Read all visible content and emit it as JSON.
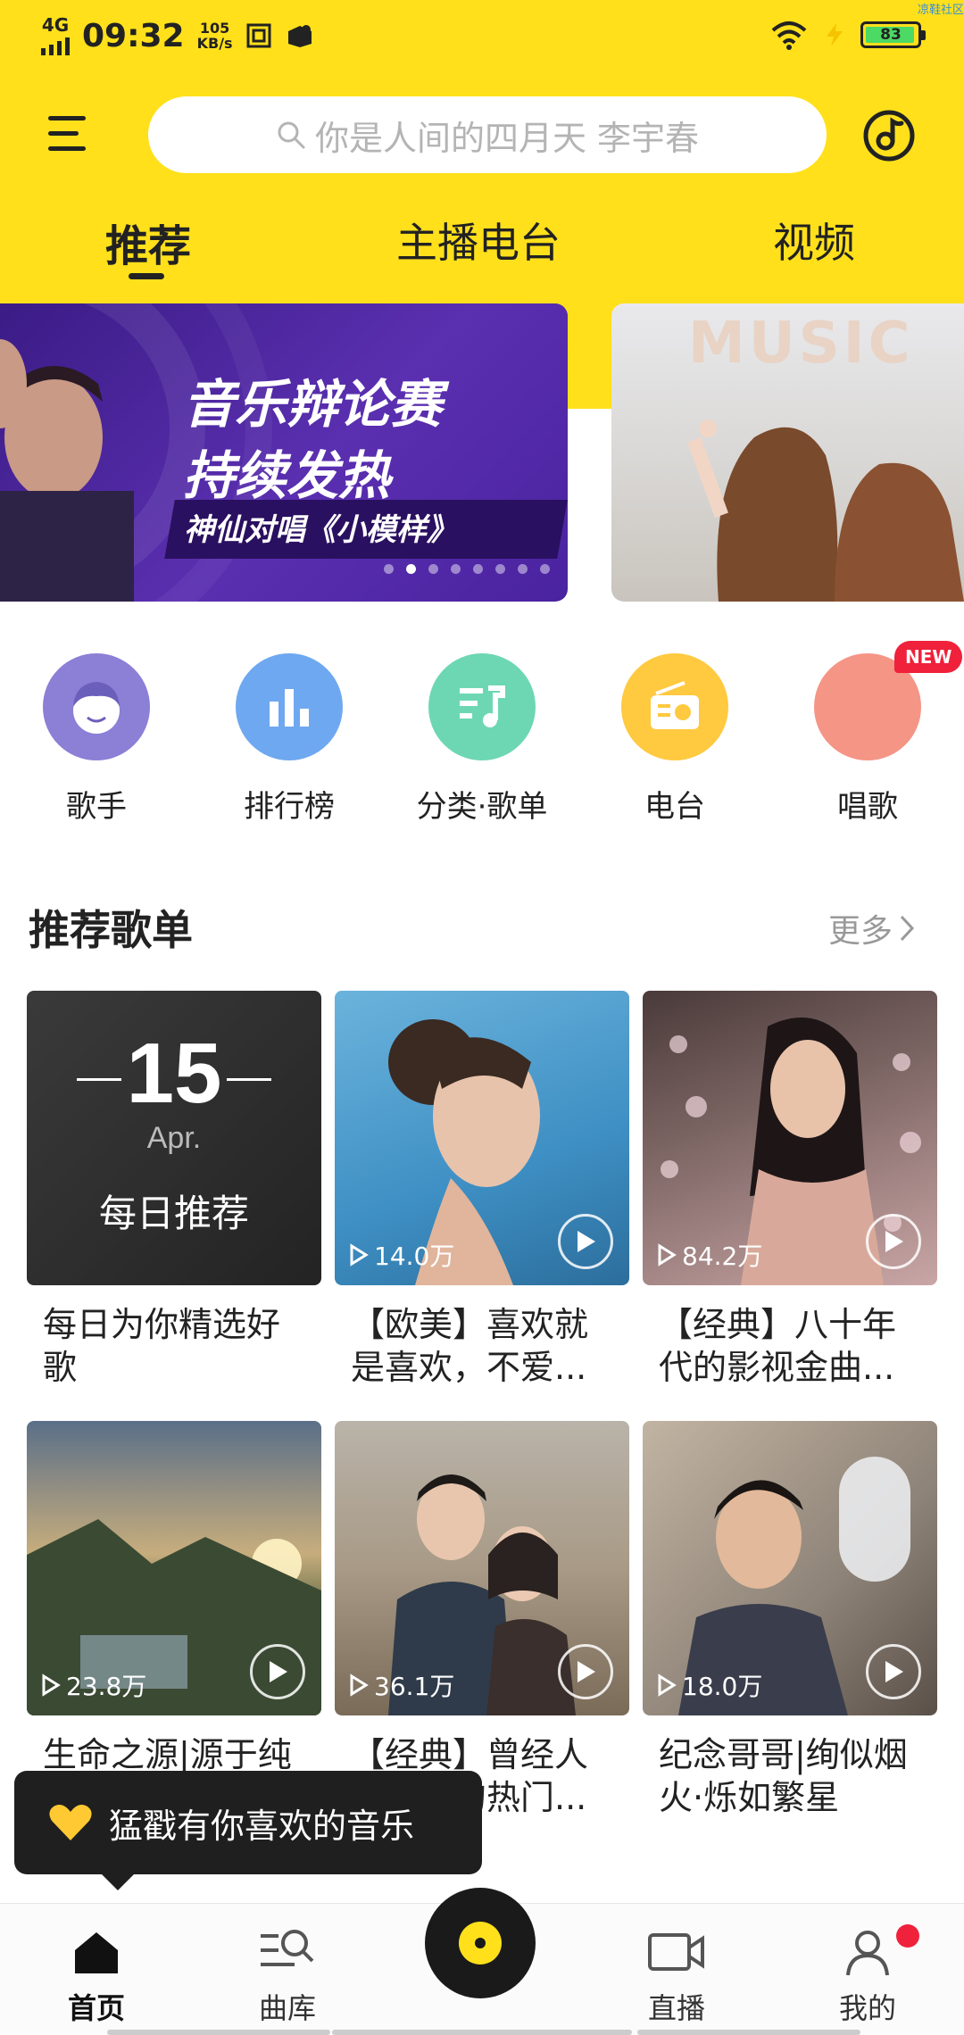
{
  "status_bar": {
    "network": "4G",
    "time": "09:32",
    "speed_value": "105",
    "speed_unit": "KB/s",
    "battery": "83",
    "corner_tag": "凉鞋社区"
  },
  "header": {
    "search_placeholder": "你是人间的四月天 李宇春",
    "tabs": [
      "推荐",
      "主播电台",
      "视频"
    ],
    "active_tab": 0
  },
  "banner": {
    "title_line1": "音乐辩论赛",
    "title_line2": "持续发热",
    "subtitle": "神仙对唱《小模样》",
    "side_text": "MUSIC",
    "dots_count": 8,
    "active_dot": 1
  },
  "categories": [
    {
      "label": "歌手",
      "icon": "singer-icon",
      "color": "#8b7fd6"
    },
    {
      "label": "排行榜",
      "icon": "chart-icon",
      "color": "#6ea8f0"
    },
    {
      "label": "分类·歌单",
      "icon": "playlist-icon",
      "color": "#6dd7b4"
    },
    {
      "label": "电台",
      "icon": "radio-icon",
      "color": "#ffc940"
    },
    {
      "label": "唱歌",
      "icon": "sing-icon",
      "color": "#f59585"
    }
  ],
  "new_badge": "NEW",
  "section": {
    "title": "推荐歌单",
    "more": "更多"
  },
  "daily": {
    "day": "15",
    "month": "Apr.",
    "label": "每日推荐"
  },
  "playlists": [
    {
      "title": "每日为你精选好歌",
      "play_count": ""
    },
    {
      "title": "【欧美】喜欢就是喜欢，不爱...",
      "play_count": "14.0万"
    },
    {
      "title": "【经典】八十年代的影视金曲...",
      "play_count": "84.2万"
    },
    {
      "title": "生命之源|源于纯音乐",
      "play_count": "23.8万"
    },
    {
      "title": "【经典】曾经人人传唱的热门...",
      "play_count": "36.1万"
    },
    {
      "title": "纪念哥哥|绚似烟火·烁如繁星",
      "play_count": "18.0万"
    }
  ],
  "toast": {
    "text": "猛戳有你喜欢的音乐"
  },
  "bottom_nav": [
    {
      "label": "首页",
      "icon": "home-icon"
    },
    {
      "label": "曲库",
      "icon": "library-icon"
    },
    {
      "label": "直播",
      "icon": "live-icon"
    },
    {
      "label": "我的",
      "icon": "profile-icon"
    }
  ],
  "colors": {
    "brand_yellow": "#ffe01b",
    "badge_red": "#f0213a"
  }
}
